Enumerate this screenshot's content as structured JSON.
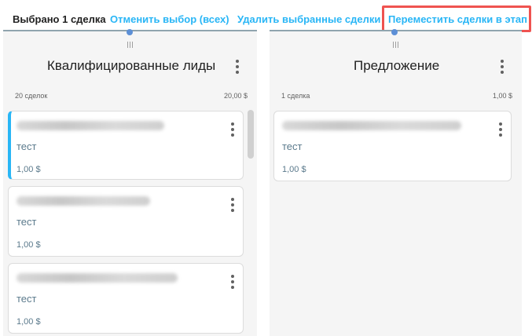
{
  "topbar": {
    "selected_count": "Выбрано 1 сделка",
    "cancel_selection": "Отменить выбор (всех)",
    "delete_selected": "Удалить выбранные сделки",
    "move_to_stage": "Переместить сделки в этап"
  },
  "columns": [
    {
      "title": "Квалифицированные лиды",
      "count": "20 сделок",
      "total": "20,00 $",
      "cards": [
        {
          "name": "тест",
          "amount": "1,00 $",
          "selected": true
        },
        {
          "name": "тест",
          "amount": "1,00 $",
          "selected": false
        },
        {
          "name": "тест",
          "amount": "1,00 $",
          "selected": false
        }
      ]
    },
    {
      "title": "Предложение",
      "count": "1 сделка",
      "total": "1,00 $",
      "cards": [
        {
          "name": "тест",
          "amount": "1,00 $",
          "selected": false
        }
      ]
    }
  ],
  "colors": {
    "accent": "#29b6f6",
    "highlight": "#ef5350",
    "column_bg": "#f5f5f5"
  }
}
